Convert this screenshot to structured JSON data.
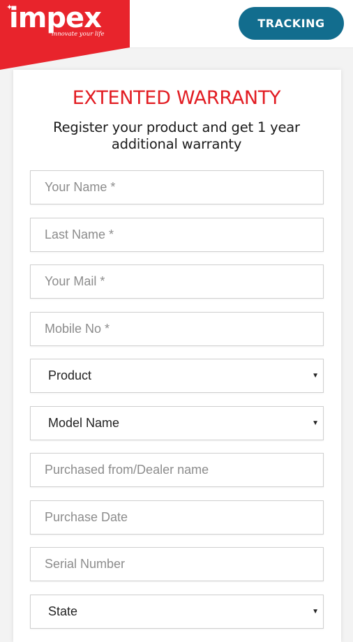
{
  "header": {
    "logo_text": "impex",
    "logo_tagline": "innovate your life",
    "tracking_label": "TRACKING"
  },
  "colors": {
    "brand_red": "#e8242c",
    "title_red": "#e21d23",
    "tracking_button": "#126d8e"
  },
  "form": {
    "title": "EXTENTED WARRANTY",
    "subtitle": "Register your product and get 1 year additional warranty",
    "fields": {
      "first_name": {
        "placeholder": "Your Name *"
      },
      "last_name": {
        "placeholder": "Last Name *"
      },
      "email": {
        "placeholder": "Your Mail *"
      },
      "mobile": {
        "placeholder": "Mobile No *"
      },
      "product": {
        "selected": "Product",
        "icon": "caret-down-icon"
      },
      "model": {
        "selected": "Model Name",
        "icon": "caret-down-icon"
      },
      "dealer": {
        "placeholder": "Purchased from/Dealer name"
      },
      "purchase_date": {
        "placeholder": "Purchase Date"
      },
      "serial": {
        "placeholder": "Serial Number"
      },
      "state": {
        "selected": "State",
        "icon": "caret-down-icon"
      }
    }
  }
}
